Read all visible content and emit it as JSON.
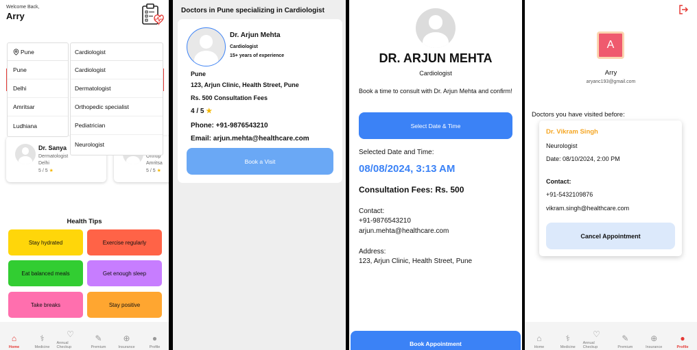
{
  "home": {
    "welcome": "Welcome Back,",
    "username": "Arry",
    "city_dropdown": {
      "selected": "Pune",
      "options": [
        "Pune",
        "Delhi",
        "Amritsar",
        "Ludhiana"
      ]
    },
    "specialty_dropdown": {
      "selected": "Cardiologist",
      "options": [
        "Cardiologist",
        "Dermatologist",
        "Orthopedic specialist",
        "Pediatrician",
        "Neurologist"
      ]
    },
    "doctor_card_1": {
      "name": "Dr. Sanya",
      "specialty": "Dermatologist",
      "city": "Delhi",
      "rating": "5 / 5"
    },
    "doctor_card_2": {
      "specialty": "Orthop",
      "city": "Amritsa",
      "rating": "5 / 5"
    },
    "tips_title": "Health Tips",
    "tips": [
      {
        "label": "Stay hydrated",
        "color": "#ffd60a"
      },
      {
        "label": "Exercise regularly",
        "color": "#ff6347"
      },
      {
        "label": "Eat balanced meals",
        "color": "#32cd32"
      },
      {
        "label": "Get enough sleep",
        "color": "#c77dff"
      },
      {
        "label": "Take breaks",
        "color": "#ff6fae"
      },
      {
        "label": "Stay positive",
        "color": "#ffa630"
      }
    ]
  },
  "nav": {
    "items": [
      "Home",
      "Medicine",
      "Annual Checkup",
      "Premium",
      "Insurance",
      "Profile"
    ]
  },
  "search": {
    "title": "Doctors in Pune specializing in Cardiologist",
    "doctor": {
      "name": "Dr. Arjun Mehta",
      "specialty": "Cardiologist",
      "experience": "15+ years of experience",
      "city": "Pune",
      "address": "123, Arjun Clinic, Health Street, Pune",
      "fees": "Rs. 500 Consultation Fees",
      "rating": "4 / 5",
      "phone": "Phone: +91-9876543210",
      "email": "Email: arjun.mehta@healthcare.com"
    },
    "book_button": "Book a Visit"
  },
  "detail": {
    "name": "DR. ARJUN MEHTA",
    "specialty": "Cardiologist",
    "intro": "Book a time to consult with Dr. Arjun Mehta and confirm!",
    "select_button": "Select Date & Time",
    "selected_label": "Selected Date and Time:",
    "selected_value": "08/08/2024, 3:13 AM",
    "fees": "Consultation Fees: Rs. 500",
    "contact_label": "Contact:",
    "contact_phone": "+91-9876543210",
    "contact_email": "arjun.mehta@healthcare.com",
    "address_label": "Address:",
    "address": "123, Arjun Clinic, Health Street, Pune",
    "book_button": "Book Appointment"
  },
  "profile": {
    "avatar_letter": "A",
    "name": "Arry",
    "email": "aryanc193@gmail.com",
    "visited_label": "Doctors you have visited before:",
    "visit": {
      "doctor": "Dr. Vikram Singh",
      "specialty": "Neurologist",
      "date": "Date: 08/10/2024, 2:00 PM",
      "contact_label": "Contact:",
      "phone": "+91-5432109876",
      "email": "vikram.singh@healthcare.com"
    },
    "cancel_button": "Cancel Appointment"
  },
  "colors": {
    "accent_blue": "#3b82f6",
    "light_blue": "#6aa8f5",
    "brand_red": "#e53935",
    "orange": "#f5a623"
  }
}
